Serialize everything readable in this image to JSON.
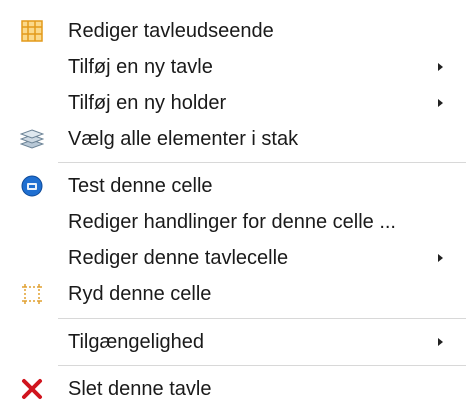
{
  "menu": {
    "items": [
      {
        "label": "Rediger tavleudseende",
        "icon": "grid-table-icon",
        "submenu": false
      },
      {
        "label": "Tilføj en ny tavle",
        "icon": null,
        "submenu": true
      },
      {
        "label": "Tilføj en ny holder",
        "icon": null,
        "submenu": true
      },
      {
        "label": "Vælg alle elementer i stak",
        "icon": "stack-layers-icon",
        "submenu": false
      },
      {
        "label": "Test denne celle",
        "icon": "test-circle-icon",
        "submenu": false
      },
      {
        "label": "Rediger handlinger for denne celle ...",
        "icon": null,
        "submenu": false
      },
      {
        "label": "Rediger denne tavlecelle",
        "icon": null,
        "submenu": true
      },
      {
        "label": "Ryd denne celle",
        "icon": "clear-cell-icon",
        "submenu": false
      },
      {
        "label": "Tilgængelighed",
        "icon": null,
        "submenu": true
      },
      {
        "label": "Slet denne tavle",
        "icon": "delete-x-icon",
        "submenu": false
      }
    ]
  },
  "colors": {
    "grid_icon": "#f0a020",
    "test_icon": "#1f6fd1",
    "delete_icon": "#d0141e",
    "stack_icon": "#8aa8c0"
  }
}
